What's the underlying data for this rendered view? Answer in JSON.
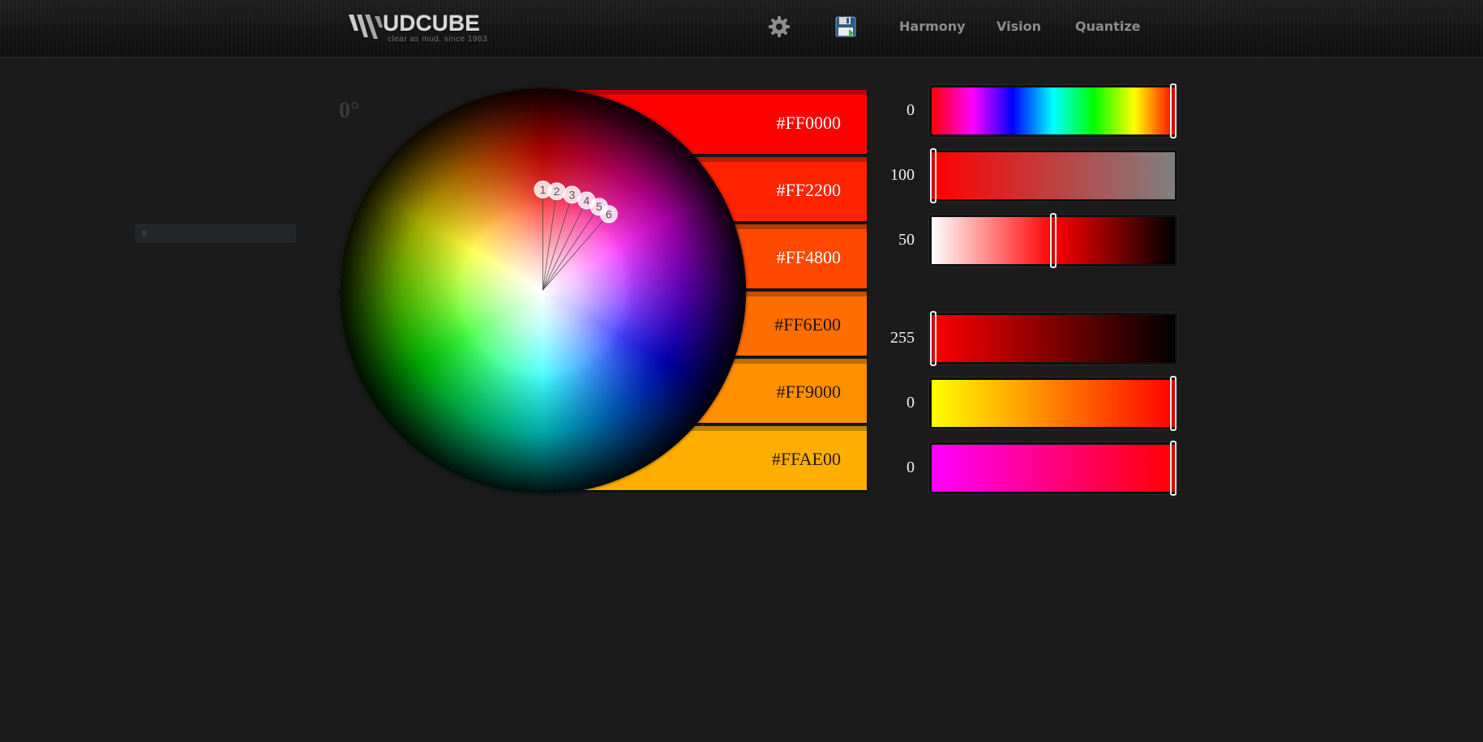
{
  "header": {
    "logo_text": "UDCUBE",
    "logo_tagline": "clear as mud, since 1983",
    "nav": {
      "settings_icon": "gear-icon",
      "save_icon": "save-floppy-icon",
      "harmony": "Harmony",
      "vision": "Vision",
      "quantize": "Quantize"
    }
  },
  "wheel": {
    "angle_label": "0°",
    "markers": [
      {
        "label": "1",
        "hue_deg": 0
      },
      {
        "label": "2",
        "hue_deg": 8
      },
      {
        "label": "3",
        "hue_deg": 17
      },
      {
        "label": "4",
        "hue_deg": 26
      },
      {
        "label": "5",
        "hue_deg": 34
      },
      {
        "label": "6",
        "hue_deg": 41
      }
    ]
  },
  "swatches": [
    {
      "hex": "#FF0000",
      "text_color": "#ffffff"
    },
    {
      "hex": "#FF2200",
      "text_color": "#ffffff"
    },
    {
      "hex": "#FF4800",
      "text_color": "#ffffff"
    },
    {
      "hex": "#FF6E00",
      "text_color": "#2a1200"
    },
    {
      "hex": "#FF9000",
      "text_color": "#2a1600"
    },
    {
      "hex": "#FFAE00",
      "text_color": "#2a1a00"
    }
  ],
  "sliders": [
    {
      "name": "hue",
      "value": "0",
      "fraction": 1.0
    },
    {
      "name": "saturation",
      "value": "100",
      "fraction": 0.0
    },
    {
      "name": "lightness",
      "value": "50",
      "fraction": 0.5
    },
    {
      "name": "red",
      "value": "255",
      "fraction": 0.0
    },
    {
      "name": "green",
      "value": "0",
      "fraction": 1.0
    },
    {
      "name": "blue",
      "value": "0",
      "fraction": 1.0
    }
  ]
}
